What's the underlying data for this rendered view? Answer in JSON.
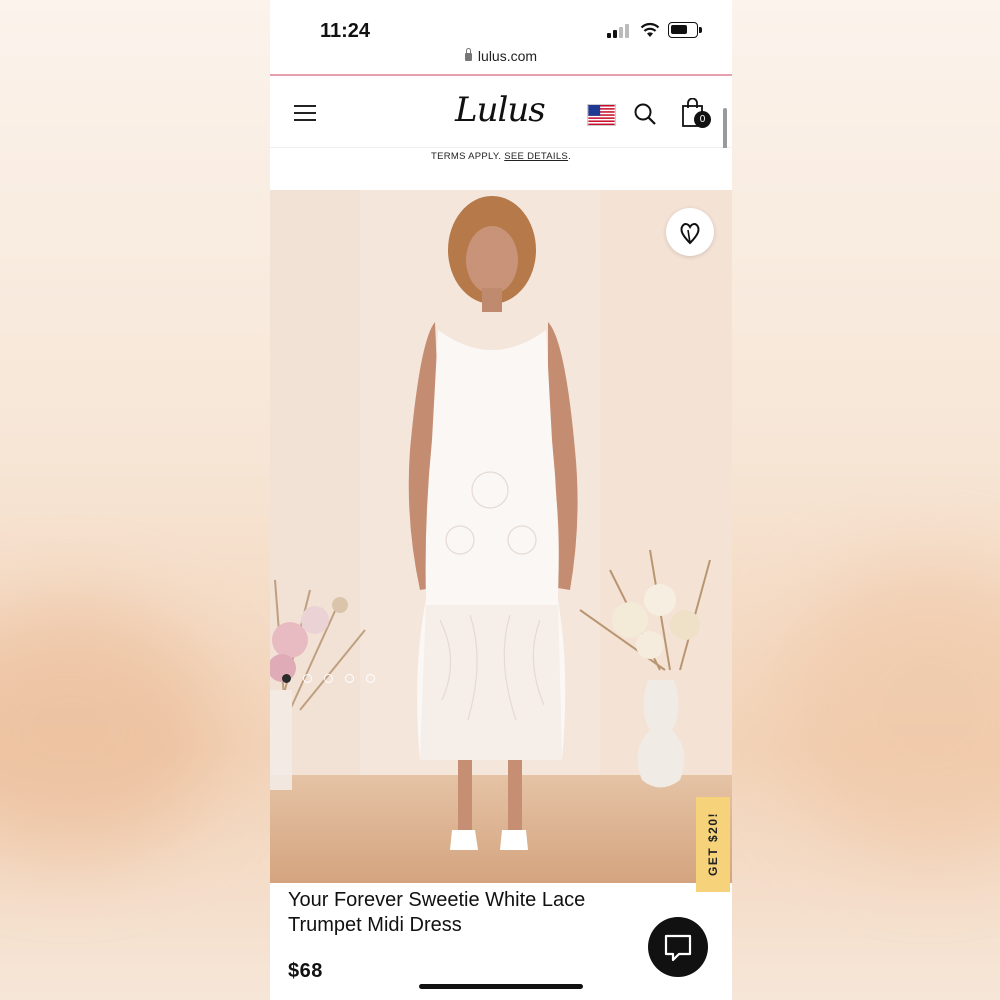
{
  "status_bar": {
    "time": "11:24"
  },
  "browser": {
    "url": "lulus.com"
  },
  "header": {
    "logo": "Lulus",
    "cart_count": "0"
  },
  "promo": {
    "terms_text": "TERMS APPLY.",
    "details_link": "SEE DETAILS",
    "trailing": "."
  },
  "gallery": {
    "image_count": 5,
    "active_index": 0
  },
  "product": {
    "title": "Your Forever Sweetie White Lace Trumpet Midi Dress",
    "price": "$68"
  },
  "offer_tab": {
    "label": "GET $20!"
  },
  "colors": {
    "accent_line": "#e8a0b0",
    "offer_tab": "#f6d27a",
    "text": "#111111"
  },
  "icons": {
    "menu": "hamburger-icon",
    "flag": "us-flag-icon",
    "search": "search-icon",
    "cart": "shopping-bag-icon",
    "wishlist": "heart-icon",
    "chat": "chat-icon",
    "lock": "lock-icon"
  }
}
